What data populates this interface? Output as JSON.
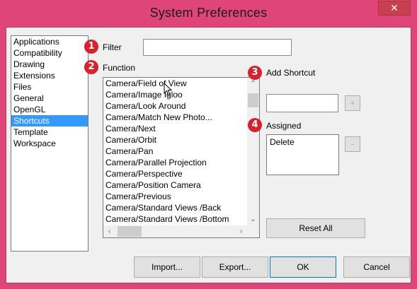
{
  "window": {
    "title": "System Preferences",
    "close_glyph": "✕"
  },
  "categories": [
    {
      "label": "Applications",
      "selected": false
    },
    {
      "label": "Compatibility",
      "selected": false
    },
    {
      "label": "Drawing",
      "selected": false
    },
    {
      "label": "Extensions",
      "selected": false
    },
    {
      "label": "Files",
      "selected": false
    },
    {
      "label": "General",
      "selected": false
    },
    {
      "label": "OpenGL",
      "selected": false
    },
    {
      "label": "Shortcuts",
      "selected": true
    },
    {
      "label": "Template",
      "selected": false
    },
    {
      "label": "Workspace",
      "selected": false
    }
  ],
  "badges": {
    "b1": "1",
    "b2": "2",
    "b3": "3",
    "b4": "4"
  },
  "filter": {
    "label": "Filter",
    "value": ""
  },
  "function": {
    "label": "Function",
    "items": [
      "Camera/Field of View",
      "Camera/Image Igloo",
      "Camera/Look Around",
      "Camera/Match New Photo...",
      "Camera/Next",
      "Camera/Orbit",
      "Camera/Pan",
      "Camera/Parallel Projection",
      "Camera/Perspective",
      "Camera/Position Camera",
      "Camera/Previous",
      "Camera/Standard Views /Back",
      "Camera/Standard Views /Bottom"
    ]
  },
  "add_shortcut": {
    "label": "Add Shortcut",
    "value": "",
    "add_glyph": "+"
  },
  "assigned": {
    "label": "Assigned",
    "items": [
      "Delete"
    ],
    "remove_glyph": "-"
  },
  "buttons": {
    "reset_all": "Reset All",
    "import": "Import...",
    "export": "Export...",
    "ok": "OK",
    "cancel": "Cancel"
  },
  "colors": {
    "frame": "#e0457a",
    "selection": "#3399ff",
    "badge": "#d9202c"
  }
}
